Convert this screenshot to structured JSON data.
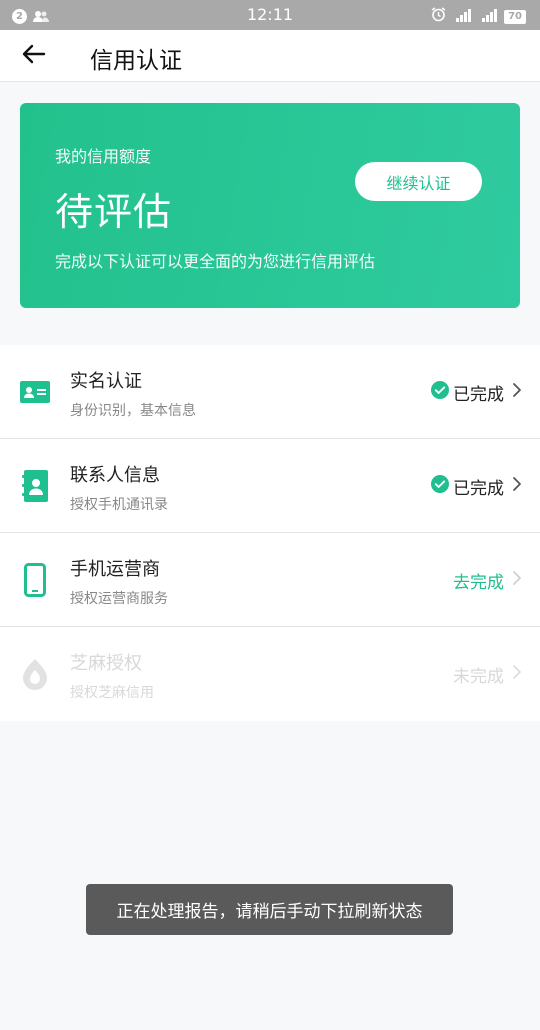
{
  "statusbar": {
    "notif_count": "2",
    "time": "12:11",
    "battery": "70"
  },
  "header": {
    "title": "信用认证"
  },
  "card": {
    "label": "我的信用额度",
    "status": "待评估",
    "button": "继续认证",
    "desc": "完成以下认证可以更全面的为您进行信用评估"
  },
  "items": [
    {
      "title": "实名认证",
      "sub": "身份识别，基本信息",
      "status": "已完成",
      "icon": "id-card-icon"
    },
    {
      "title": "联系人信息",
      "sub": "授权手机通讯录",
      "status": "已完成",
      "icon": "contacts-book-icon"
    },
    {
      "title": "手机运营商",
      "sub": "授权运营商服务",
      "status": "去完成",
      "icon": "mobile-phone-icon"
    },
    {
      "title": "芝麻授权",
      "sub": "授权芝麻信用",
      "status": "未完成",
      "icon": "sesame-icon"
    }
  ],
  "toast": "正在处理报告，请稍后手动下拉刷新状态",
  "colors": {
    "accent": "#1fbf8f",
    "card_start": "#22c18c",
    "card_end": "#2fcba0"
  }
}
